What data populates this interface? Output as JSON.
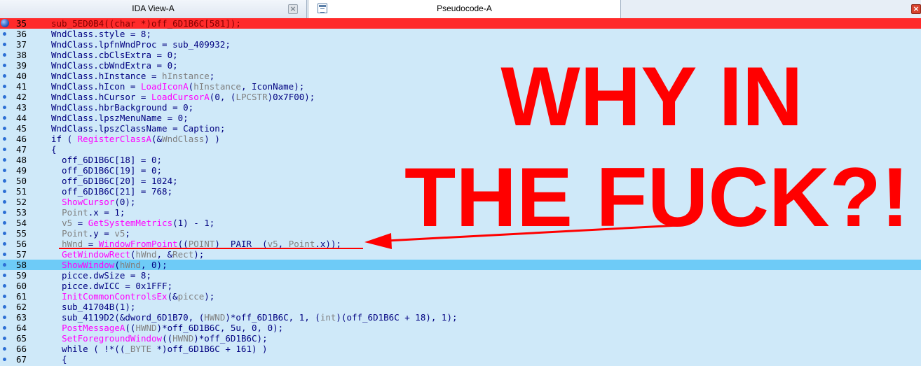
{
  "tabs": [
    {
      "label": "IDA View-A",
      "active": false,
      "close": "×"
    },
    {
      "label": "Pseudocode-A",
      "active": true,
      "close": "×"
    }
  ],
  "meme": {
    "line1": "WHY IN",
    "line2": "THE FUCK?!"
  },
  "colors": {
    "background": "#cfe9f9",
    "current_line": "#6ecbf7",
    "breakpoint_line": "#ff2a2a",
    "annotation": "#ff0000",
    "function": "#ff00ff"
  },
  "lines": [
    {
      "n": "35",
      "h": "red",
      "bp": "big",
      "c": [
        {
          "t": "sub_5ED0B4((char *)off_6D1B6C[581]);"
        }
      ]
    },
    {
      "n": "36",
      "c": [
        {
          "t": "WndClass.style = 8;"
        }
      ]
    },
    {
      "n": "37",
      "c": [
        {
          "t": "WndClass.lpfnWndProc = sub_409932;"
        }
      ]
    },
    {
      "n": "38",
      "c": [
        {
          "t": "WndClass.cbClsExtra = 0;"
        }
      ]
    },
    {
      "n": "39",
      "c": [
        {
          "t": "WndClass.cbWndExtra = 0;"
        }
      ]
    },
    {
      "n": "40",
      "c": [
        {
          "t": "WndClass.hInstance = "
        },
        {
          "t": "hInstance",
          "k": "ty"
        },
        {
          "t": ";"
        }
      ]
    },
    {
      "n": "41",
      "c": [
        {
          "t": "WndClass.hIcon = "
        },
        {
          "t": "LoadIconA",
          "k": "fn"
        },
        {
          "t": "("
        },
        {
          "t": "hInstance",
          "k": "ty"
        },
        {
          "t": ", IconName);"
        }
      ]
    },
    {
      "n": "42",
      "c": [
        {
          "t": "WndClass.hCursor = "
        },
        {
          "t": "LoadCursorA",
          "k": "fn"
        },
        {
          "t": "(0, ("
        },
        {
          "t": "LPCSTR",
          "k": "ty"
        },
        {
          "t": ")0x7F00);"
        }
      ]
    },
    {
      "n": "43",
      "c": [
        {
          "t": "WndClass.hbrBackground = 0;"
        }
      ]
    },
    {
      "n": "44",
      "c": [
        {
          "t": "WndClass.lpszMenuName = 0;"
        }
      ]
    },
    {
      "n": "45",
      "c": [
        {
          "t": "WndClass.lpszClassName = Caption;"
        }
      ]
    },
    {
      "n": "46",
      "c": [
        {
          "t": "if ( "
        },
        {
          "t": "RegisterClassA",
          "k": "fn"
        },
        {
          "t": "(&"
        },
        {
          "t": "WndClass",
          "k": "ty"
        },
        {
          "t": ") )"
        }
      ]
    },
    {
      "n": "47",
      "c": [
        {
          "t": "{"
        }
      ]
    },
    {
      "n": "48",
      "c": [
        {
          "t": "  off_6D1B6C[18] = 0;"
        }
      ]
    },
    {
      "n": "49",
      "c": [
        {
          "t": "  off_6D1B6C[19] = 0;"
        }
      ]
    },
    {
      "n": "50",
      "c": [
        {
          "t": "  off_6D1B6C[20] = 1024;"
        }
      ]
    },
    {
      "n": "51",
      "c": [
        {
          "t": "  off_6D1B6C[21] = 768;"
        }
      ]
    },
    {
      "n": "52",
      "c": [
        {
          "t": "  "
        },
        {
          "t": "ShowCursor",
          "k": "fn"
        },
        {
          "t": "(0);"
        }
      ]
    },
    {
      "n": "53",
      "c": [
        {
          "t": "  "
        },
        {
          "t": "Point",
          "k": "ty"
        },
        {
          "t": ".x = 1;"
        }
      ]
    },
    {
      "n": "54",
      "c": [
        {
          "t": "  "
        },
        {
          "t": "v5",
          "k": "ty"
        },
        {
          "t": " = "
        },
        {
          "t": "GetSystemMetrics",
          "k": "fn"
        },
        {
          "t": "(1) - 1;"
        }
      ]
    },
    {
      "n": "55",
      "c": [
        {
          "t": "  "
        },
        {
          "t": "Point",
          "k": "ty"
        },
        {
          "t": ".y = "
        },
        {
          "t": "v5",
          "k": "ty"
        },
        {
          "t": ";"
        }
      ]
    },
    {
      "n": "56",
      "c": [
        {
          "t": "  "
        },
        {
          "t": "hWnd",
          "k": "ty"
        },
        {
          "t": " = "
        },
        {
          "t": "WindowFromPoint",
          "k": "fn"
        },
        {
          "t": "(("
        },
        {
          "t": "POINT",
          "k": "ty"
        },
        {
          "t": ")__PAIR__("
        },
        {
          "t": "v5",
          "k": "ty"
        },
        {
          "t": ", "
        },
        {
          "t": "Point",
          "k": "ty"
        },
        {
          "t": ".x));"
        }
      ]
    },
    {
      "n": "57",
      "c": [
        {
          "t": "  "
        },
        {
          "t": "GetWindowRect",
          "k": "fn"
        },
        {
          "t": "("
        },
        {
          "t": "hWnd",
          "k": "ty"
        },
        {
          "t": ", &"
        },
        {
          "t": "Rect",
          "k": "ty"
        },
        {
          "t": ");"
        }
      ]
    },
    {
      "n": "58",
      "h": "blue",
      "c": [
        {
          "t": "  "
        },
        {
          "t": "ShowWindow",
          "k": "fn"
        },
        {
          "t": "("
        },
        {
          "t": "hWnd",
          "k": "ty"
        },
        {
          "t": ", 0);"
        }
      ]
    },
    {
      "n": "59",
      "c": [
        {
          "t": "  picce.dwSize = 8;"
        }
      ]
    },
    {
      "n": "60",
      "c": [
        {
          "t": "  picce.dwICC = 0x1FFF;"
        }
      ]
    },
    {
      "n": "61",
      "c": [
        {
          "t": "  "
        },
        {
          "t": "InitCommonControlsEx",
          "k": "fn"
        },
        {
          "t": "(&"
        },
        {
          "t": "picce",
          "k": "ty"
        },
        {
          "t": ");"
        }
      ]
    },
    {
      "n": "62",
      "c": [
        {
          "t": "  sub_41704B(1);"
        }
      ]
    },
    {
      "n": "63",
      "c": [
        {
          "t": "  sub_4119D2(&dword_6D1B70, ("
        },
        {
          "t": "HWND",
          "k": "ty"
        },
        {
          "t": ")*off_6D1B6C, 1, ("
        },
        {
          "t": "int",
          "k": "ty"
        },
        {
          "t": ")(off_6D1B6C + 18), 1);"
        }
      ]
    },
    {
      "n": "64",
      "c": [
        {
          "t": "  "
        },
        {
          "t": "PostMessageA",
          "k": "fn"
        },
        {
          "t": "(("
        },
        {
          "t": "HWND",
          "k": "ty"
        },
        {
          "t": ")*off_6D1B6C, 5u, 0, 0);"
        }
      ]
    },
    {
      "n": "65",
      "c": [
        {
          "t": "  "
        },
        {
          "t": "SetForegroundWindow",
          "k": "fn"
        },
        {
          "t": "(("
        },
        {
          "t": "HWND",
          "k": "ty"
        },
        {
          "t": ")*off_6D1B6C);"
        }
      ]
    },
    {
      "n": "66",
      "c": [
        {
          "t": "  while ( !*(("
        },
        {
          "t": "_BYTE",
          "k": "ty"
        },
        {
          "t": " *)off_6D1B6C + 161) )"
        }
      ]
    },
    {
      "n": "67",
      "c": [
        {
          "t": "  {"
        }
      ]
    }
  ]
}
